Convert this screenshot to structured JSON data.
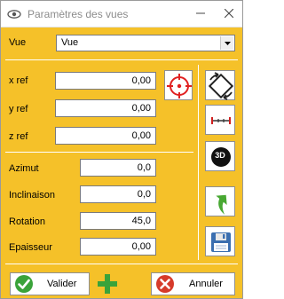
{
  "window": {
    "title": "Paramètres des vues"
  },
  "view": {
    "label": "Vue",
    "selected": "Vue"
  },
  "refs": [
    {
      "label": "x ref",
      "value": "0,00"
    },
    {
      "label": "y ref",
      "value": "0,00"
    },
    {
      "label": "z ref",
      "value": "0,00"
    }
  ],
  "params": [
    {
      "label": "Azimut",
      "value": "0,0"
    },
    {
      "label": "Inclinaison",
      "value": "0,0"
    },
    {
      "label": "Rotation",
      "value": "45,0"
    },
    {
      "label": "Epaisseur",
      "value": "0,00"
    }
  ],
  "tools": {
    "three_d_label": "3D"
  },
  "buttons": {
    "validate": "Valider",
    "cancel": "Annuler"
  },
  "colors": {
    "panel": "#f5c129",
    "target_red": "#e02020",
    "validate_green": "#3aa33a",
    "add_green": "#3aa33a",
    "cancel_red": "#d63a2a",
    "arrow_green": "#48a832",
    "save_blue": "#3b6fb0"
  }
}
